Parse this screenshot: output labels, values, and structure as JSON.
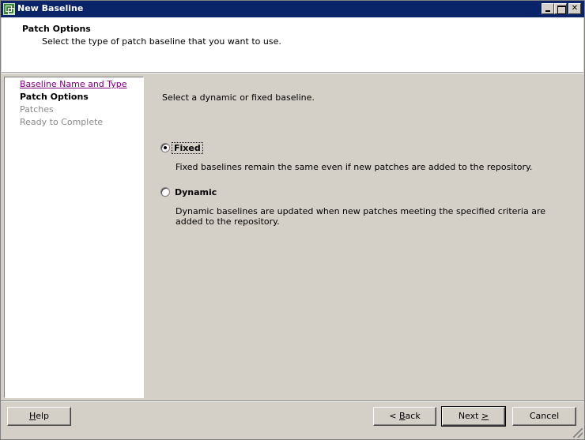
{
  "window": {
    "title": "New Baseline",
    "controls": {
      "minimize": "",
      "maximize": "",
      "close": "✕"
    }
  },
  "header": {
    "title": "Patch Options",
    "subtitle": "Select the type of patch baseline that you want to use."
  },
  "nav": {
    "items": [
      {
        "label": "Baseline Name and Type",
        "state": "visited"
      },
      {
        "label": "Patch Options",
        "state": "current"
      },
      {
        "label": "Patches",
        "state": "disabled"
      },
      {
        "label": "Ready to Complete",
        "state": "disabled"
      }
    ]
  },
  "content": {
    "prompt": "Select a dynamic or fixed baseline.",
    "options": [
      {
        "label": "Fixed",
        "selected": true,
        "description": "Fixed baselines remain the same even if new patches are added to the repository."
      },
      {
        "label": "Dynamic",
        "selected": false,
        "description_line1": "Dynamic baselines are updated when new patches meeting the specified criteria are",
        "description_line2": "added to the repository."
      }
    ]
  },
  "footer": {
    "help": {
      "pre": "",
      "accel": "H",
      "post": "elp"
    },
    "back": {
      "pre": "< ",
      "accel": "B",
      "post": "ack"
    },
    "next": {
      "pre": "Next ",
      "accel": ">",
      "post": ""
    },
    "cancel": "Cancel"
  },
  "colors": {
    "titlebar": "#0a246a",
    "dialog_bg": "#d4d0c8",
    "visited_link": "#800080",
    "disabled_text": "#8a8a8a"
  },
  "icons": {
    "app": "vmware-update-manager-icon",
    "minimize": "minimize-icon",
    "maximize": "maximize-icon",
    "close": "close-icon",
    "resize": "resize-grip-icon"
  }
}
